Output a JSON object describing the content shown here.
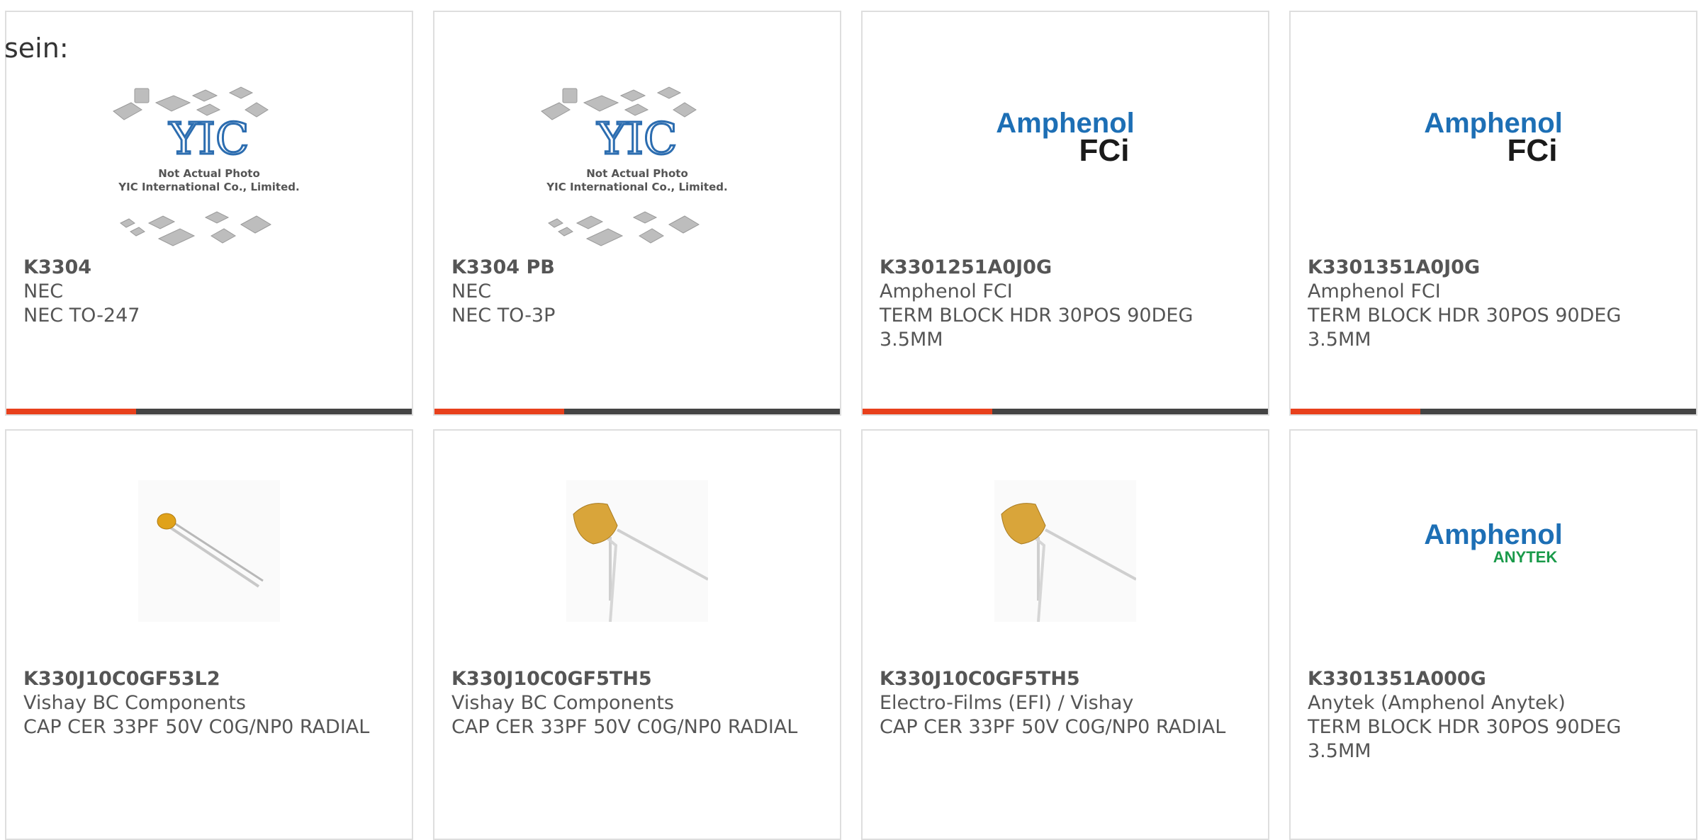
{
  "fragment_text": "sein:",
  "colors": {
    "accent_bar": "#e8401c",
    "bar_track": "#444444",
    "amphenol_blue": "#1d6fb5",
    "anytek_green": "#1a9a4a",
    "capacitor_body": "#d9a53a"
  },
  "products": [
    {
      "part_number": "K3304",
      "manufacturer": "NEC",
      "description": "NEC TO-247",
      "image": "yic-not-actual-photo",
      "image_text_1": "Not Actual Photo",
      "image_text_2": "YIC International Co., Limited.",
      "image_logo": "YIC",
      "progress": 0.32
    },
    {
      "part_number": "K3304 PB",
      "manufacturer": "NEC",
      "description": "NEC TO-3P",
      "image": "yic-not-actual-photo",
      "image_text_1": "Not Actual Photo",
      "image_text_2": "YIC International Co., Limited.",
      "image_logo": "YIC",
      "progress": 0.32
    },
    {
      "part_number": "K3301251A0J0G",
      "manufacturer": "Amphenol FCI",
      "description": "TERM BLOCK HDR 30POS 90DEG 3.5MM",
      "image": "amphenol-fci-logo",
      "logo_line_1": "Amphenol",
      "logo_line_2": "FCi",
      "progress": 0.32
    },
    {
      "part_number": "K3301351A0J0G",
      "manufacturer": "Amphenol FCI",
      "description": "TERM BLOCK HDR 30POS 90DEG 3.5MM",
      "image": "amphenol-fci-logo",
      "logo_line_1": "Amphenol",
      "logo_line_2": "FCi",
      "progress": 0.32
    },
    {
      "part_number": "K330J10C0GF53L2",
      "manufacturer": "Vishay BC Components",
      "description": "CAP CER 33PF 50V C0G/NP0 RADIAL",
      "image": "small-disc-capacitor-photo"
    },
    {
      "part_number": "K330J10C0GF5TH5",
      "manufacturer": "Vishay BC Components",
      "description": "CAP CER 33PF 50V C0G/NP0 RADIAL",
      "image": "radial-capacitor-photo"
    },
    {
      "part_number": "K330J10C0GF5TH5",
      "manufacturer": "Electro-Films (EFI) / Vishay",
      "description": "CAP CER 33PF 50V C0G/NP0 RADIAL",
      "image": "radial-capacitor-photo"
    },
    {
      "part_number": "K3301351A000G",
      "manufacturer": "Anytek (Amphenol Anytek)",
      "description": "TERM BLOCK HDR 30POS 90DEG 3.5MM",
      "image": "amphenol-anytek-logo",
      "logo_line_1": "Amphenol",
      "logo_line_2": "ANYTEK"
    }
  ]
}
